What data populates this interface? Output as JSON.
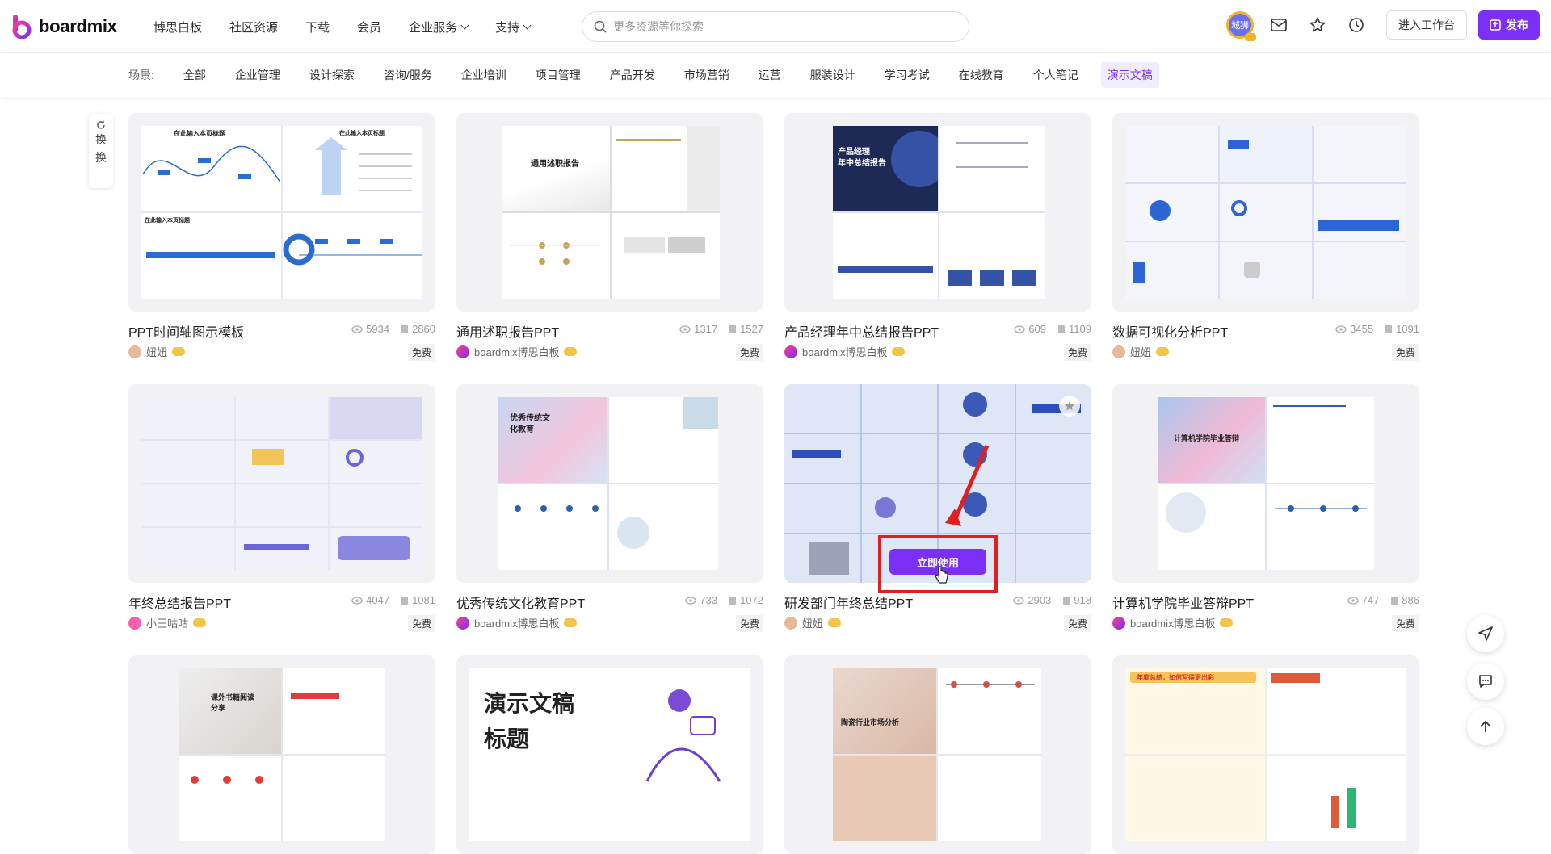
{
  "brand": {
    "name": "boardmix",
    "accent": "#7b2ff7"
  },
  "nav": {
    "items": [
      {
        "label": "博思白板",
        "dropdown": false
      },
      {
        "label": "社区资源",
        "dropdown": false
      },
      {
        "label": "下载",
        "dropdown": false
      },
      {
        "label": "会员",
        "dropdown": false
      },
      {
        "label": "企业服务",
        "dropdown": true
      },
      {
        "label": "支持",
        "dropdown": true
      }
    ]
  },
  "search": {
    "placeholder": "更多资源等你探索"
  },
  "user": {
    "avatar_text": "城狮"
  },
  "toolbar": {
    "workspace_label": "进入工作台",
    "publish_label": "发布"
  },
  "scenes": {
    "label": "场景:",
    "items": [
      "全部",
      "企业管理",
      "设计探索",
      "咨询/服务",
      "企业培训",
      "项目管理",
      "产品开发",
      "市场营销",
      "运营",
      "服装设计",
      "学习考试",
      "在线教育",
      "个人笔记",
      "演示文稿"
    ],
    "active_index": 13
  },
  "refresh": {
    "label_1": "换",
    "label_2": "换"
  },
  "cards": [
    {
      "title": "PPT时间轴图示模板",
      "views": "5934",
      "copies": "2860",
      "author": "妞妞",
      "author_type": "user",
      "badge": "免费"
    },
    {
      "title": "通用述职报告PPT",
      "views": "1317",
      "copies": "1527",
      "author": "boardmix博思白板",
      "author_type": "brand",
      "badge": "免费"
    },
    {
      "title": "产品经理年中总结报告PPT",
      "views": "609",
      "copies": "1109",
      "author": "boardmix博思白板",
      "author_type": "brand",
      "badge": "免费"
    },
    {
      "title": "数据可视化分析PPT",
      "views": "3455",
      "copies": "1091",
      "author": "妞妞",
      "author_type": "user",
      "badge": "免费"
    },
    {
      "title": "年终总结报告PPT",
      "views": "4047",
      "copies": "1081",
      "author": "小王咕咕",
      "author_type": "pink",
      "badge": "免费"
    },
    {
      "title": "优秀传统文化教育PPT",
      "views": "733",
      "copies": "1072",
      "author": "boardmix博思白板",
      "author_type": "brand",
      "badge": "免费"
    },
    {
      "title": "研发部门年终总结PPT",
      "views": "2903",
      "copies": "918",
      "author": "妞妞",
      "author_type": "user",
      "badge": "免费",
      "hover": true,
      "use_label": "立即使用"
    },
    {
      "title": "计算机学院毕业答辩PPT",
      "views": "747",
      "copies": "886",
      "author": "boardmix博思白板",
      "author_type": "brand",
      "badge": "免费"
    }
  ],
  "thumb_text": {
    "c1_a": "在此输入本页标题",
    "c1_b": "在此输入本页标题",
    "c1_c": "在此输入本页标题",
    "c2_a": "通用述职报告",
    "c3_a": "产品经理",
    "c3_b": "年中总结报告",
    "c6_a": "优秀传统文",
    "c6_b": "化教育",
    "c8_a": "计算机学院毕业答辩",
    "r3_a": "课外书籍阅读",
    "r3_b": "分享",
    "r3_c": "演示文稿",
    "r3_d": "标题",
    "r3_e": "陶瓷行业市场分析",
    "r3_f": "年度总结，如何写得更出彩"
  }
}
